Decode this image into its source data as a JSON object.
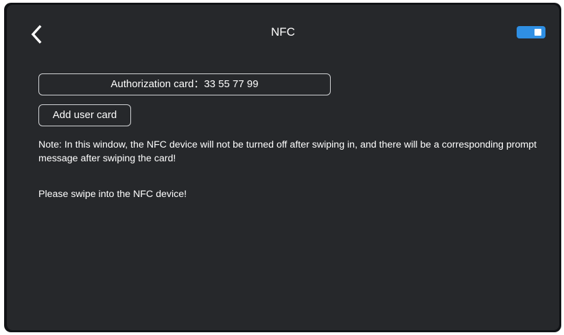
{
  "header": {
    "title": "NFC",
    "back_icon": "chevron-left-icon",
    "toggle": {
      "state": "on",
      "color": "#2f8fe3"
    }
  },
  "main": {
    "authorization_card_text": "Authorization card：33 55 77 99",
    "add_user_card_label": "Add user card",
    "note": "Note: In this window, the NFC device will not be turned off after swiping in, and there will be a corresponding prompt message after swiping the card!",
    "prompt": "Please swipe into the NFC device!"
  },
  "colors": {
    "background": "#26282b",
    "text": "#ffffff",
    "accent": "#2f8fe3",
    "border": "#d4d6d8"
  }
}
